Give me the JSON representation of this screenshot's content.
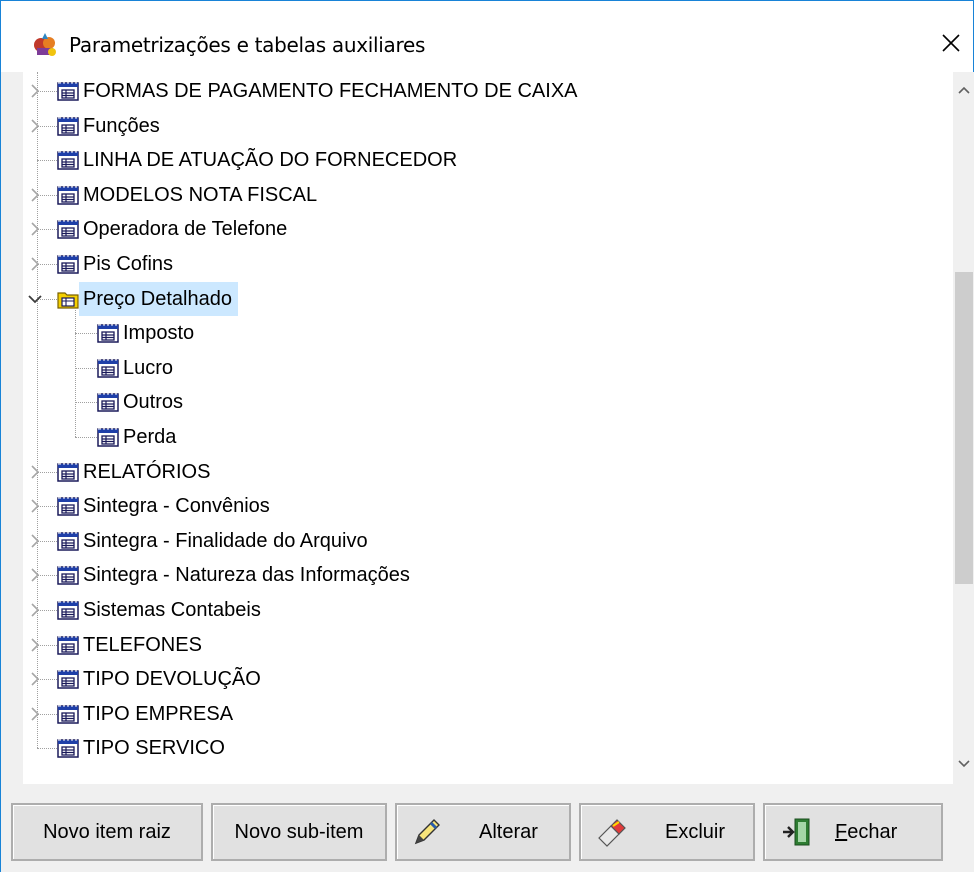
{
  "window": {
    "title": "Parametrizações e tabelas auxiliares",
    "close_glyph": "✕"
  },
  "tree": {
    "items": [
      {
        "label": "FORMAS DE PAGAMENTO FECHAMENTO DE CAIXA",
        "level": 0,
        "expander": "collapsed",
        "icon": "table-icon"
      },
      {
        "label": "Funções",
        "level": 0,
        "expander": "collapsed",
        "icon": "table-icon"
      },
      {
        "label": "LINHA DE ATUAÇÃO DO FORNECEDOR",
        "level": 0,
        "expander": "none",
        "icon": "table-icon"
      },
      {
        "label": "MODELOS NOTA FISCAL",
        "level": 0,
        "expander": "collapsed",
        "icon": "table-icon"
      },
      {
        "label": "Operadora de Telefone",
        "level": 0,
        "expander": "collapsed",
        "icon": "table-icon"
      },
      {
        "label": "Pis Cofins",
        "level": 0,
        "expander": "collapsed",
        "icon": "table-icon"
      },
      {
        "label": "Preço Detalhado",
        "level": 0,
        "expander": "expanded",
        "icon": "folder-table-icon",
        "selected": true
      },
      {
        "label": "Imposto",
        "level": 1,
        "expander": "none",
        "icon": "table-icon"
      },
      {
        "label": "Lucro",
        "level": 1,
        "expander": "none",
        "icon": "table-icon"
      },
      {
        "label": "Outros",
        "level": 1,
        "expander": "none",
        "icon": "table-icon"
      },
      {
        "label": "Perda",
        "level": 1,
        "expander": "none",
        "icon": "table-icon"
      },
      {
        "label": "RELATÓRIOS",
        "level": 0,
        "expander": "collapsed",
        "icon": "table-icon"
      },
      {
        "label": "Sintegra - Convênios",
        "level": 0,
        "expander": "collapsed",
        "icon": "table-icon"
      },
      {
        "label": "Sintegra - Finalidade do Arquivo",
        "level": 0,
        "expander": "collapsed",
        "icon": "table-icon"
      },
      {
        "label": "Sintegra - Natureza das Informações",
        "level": 0,
        "expander": "collapsed",
        "icon": "table-icon"
      },
      {
        "label": "Sistemas Contabeis",
        "level": 0,
        "expander": "collapsed",
        "icon": "table-icon"
      },
      {
        "label": "TELEFONES",
        "level": 0,
        "expander": "collapsed",
        "icon": "table-icon"
      },
      {
        "label": "TIPO DEVOLUÇÃO",
        "level": 0,
        "expander": "collapsed",
        "icon": "table-icon"
      },
      {
        "label": "TIPO EMPRESA",
        "level": 0,
        "expander": "collapsed",
        "icon": "table-icon"
      },
      {
        "label": "TIPO SERVICO",
        "level": 0,
        "expander": "none",
        "icon": "table-icon"
      }
    ]
  },
  "scrollbar": {
    "up_glyph": "^",
    "down_glyph": "v"
  },
  "buttons": {
    "novo_item_raiz": "Novo item raiz",
    "novo_sub_item": "Novo sub-item",
    "alterar": "Alterar",
    "excluir": "Excluir",
    "fechar_first": "F",
    "fechar_rest": "echar"
  },
  "colors": {
    "selection": "#cce8ff",
    "window_border": "#1883d7",
    "icon_blue": "#1f3fa8",
    "folder_yellow": "#f5d000"
  }
}
